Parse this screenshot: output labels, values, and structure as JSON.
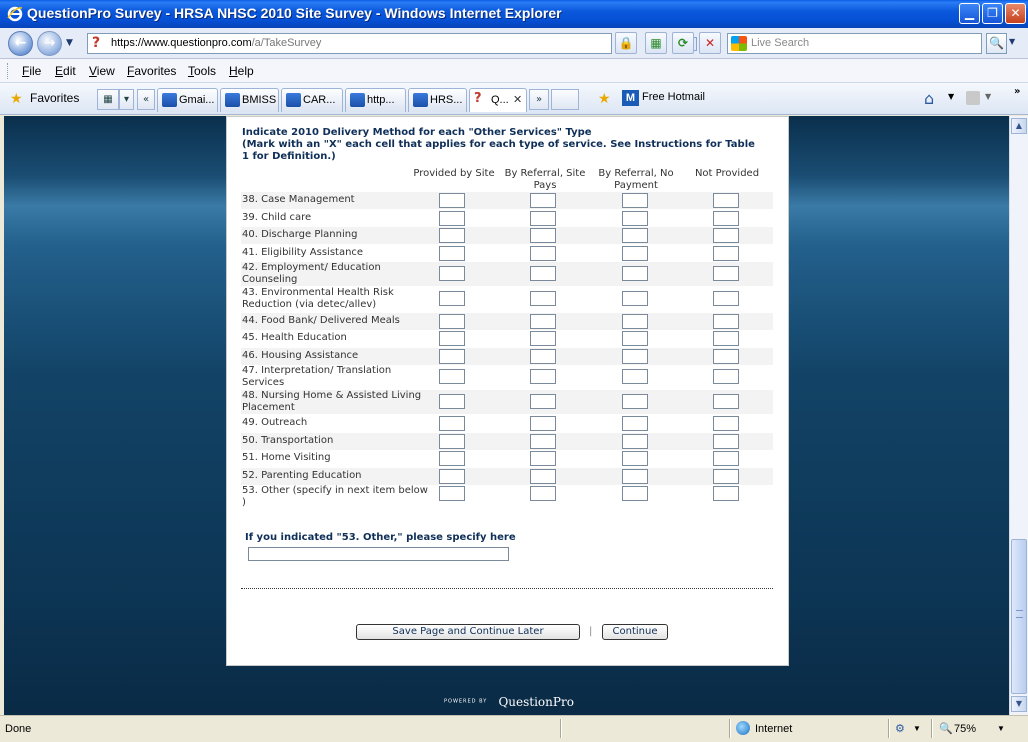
{
  "window": {
    "title": "QuestionPro Survey - HRSA NHSC 2010 Site Survey - Windows Internet Explorer",
    "min_glyph": "▁",
    "max_glyph": "❐",
    "close_glyph": "✕"
  },
  "address_bar": {
    "url_main": "https://www.questionpro.com",
    "url_path": "/a/TakeSurvey",
    "search_placeholder": "Live Search"
  },
  "menu": [
    "File",
    "Edit",
    "View",
    "Favorites",
    "Tools",
    "Help"
  ],
  "favorites_bar": {
    "favorites_label": "Favorites",
    "tabs": [
      "Gmai...",
      "BMISS",
      "CAR...",
      "http...",
      "HRS...",
      "Q..."
    ],
    "hotmail_label": "Free Hotmail"
  },
  "survey": {
    "instructions_line1": "Indicate 2010 Delivery Method for each \"Other Services\" Type",
    "instructions_line2": "(Mark with an \"X\" each cell that applies for each type of service. See Instructions for Table 1 for Definition.)",
    "columns": [
      "Provided by Site",
      "By Referral, Site Pays",
      "By Referral, No Payment",
      "Not Provided"
    ],
    "rows": [
      "38. Case Management",
      "39. Child care",
      "40. Discharge Planning",
      "41. Eligibility Assistance",
      "42. Employment/ Education Counseling",
      "43. Environmental Health Risk Reduction (via detec/allev)",
      "44. Food Bank/ Delivered Meals",
      "45. Health Education",
      "46. Housing Assistance",
      "47. Interpretation/ Translation Services",
      "48. Nursing Home & Assisted Living Placement",
      "49. Outreach",
      "50. Transportation",
      "51. Home Visiting",
      "52. Parenting Education",
      "53. Other (specify in next item below )"
    ],
    "other_label": "If you indicated \"53. Other,\" please specify here",
    "other_value": "",
    "save_button": "Save Page and Continue Later",
    "separator": "|",
    "continue_button": "Continue",
    "powered_by": "POWERED BY",
    "brand": "QuestionPro"
  },
  "status_bar": {
    "status": "Done",
    "zone": "Internet",
    "zoom": "75%"
  }
}
